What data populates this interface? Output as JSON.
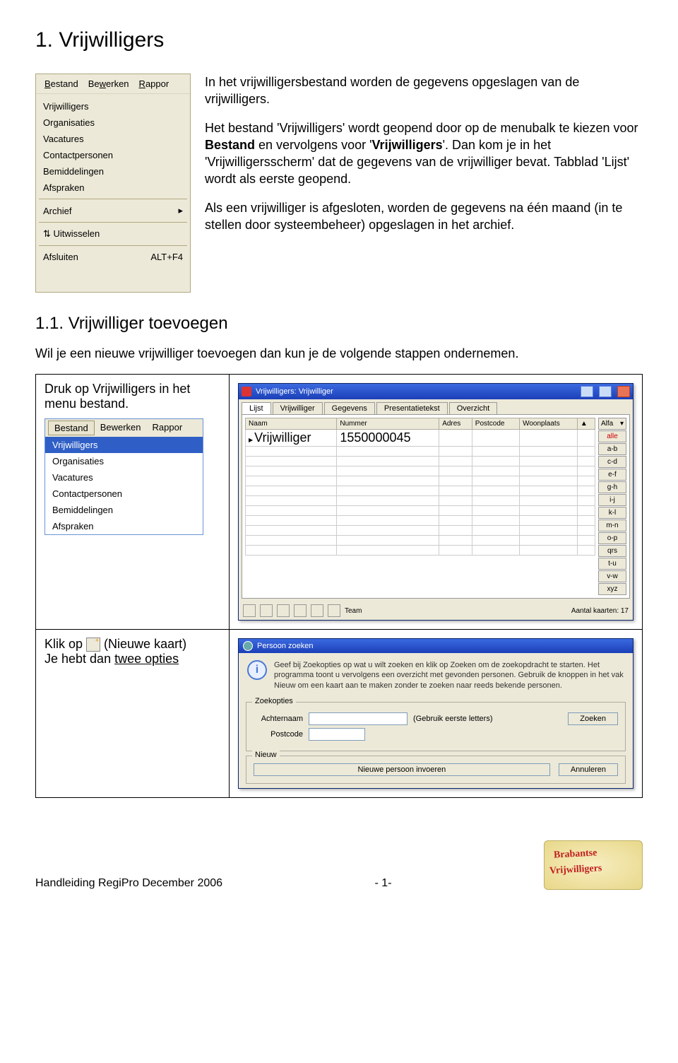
{
  "headings": {
    "h1": "1.  Vrijwilligers",
    "h2": "1.1. Vrijwilliger toevoegen"
  },
  "intro": {
    "p1": "In het vrijwilligersbestand worden de gegevens opgeslagen van de vrijwilligers.",
    "p2a": "Het bestand 'Vrijwilligers' wordt geopend door op de menubalk te kiezen voor ",
    "p2b": "Bestand",
    "p2c": " en vervolgens voor '",
    "p2d": "Vrijwilligers",
    "p2e": "'. Dan kom je in het 'Vrijwilligersscherm' dat de gegevens van de vrijwilliger bevat. Tabblad 'Lijst' wordt als eerste geopend.",
    "p3": "Als een vrijwilliger is afgesloten, worden de gegevens na één maand (in te stellen door systeembeheer) opgeslagen in het archief."
  },
  "sub_intro": "Wil je een nieuwe vrijwilliger toevoegen dan kun je de volgende stappen ondernemen.",
  "menu": {
    "bar": [
      "Bestand",
      "Bewerken",
      "Rappor"
    ],
    "items": [
      "Vrijwilligers",
      "Organisaties",
      "Vacatures",
      "Contactpersonen",
      "Bemiddelingen",
      "Afspraken"
    ],
    "archief": "Archief",
    "uitwisselen": "Uitwisselen",
    "afsluiten": "Afsluiten",
    "afsluiten_key": "ALT+F4"
  },
  "step1": {
    "text": "Druk op Vrijwilligers in het menu bestand.",
    "mini_bar": [
      "Bestand",
      "Bewerken",
      "Rappor"
    ],
    "mini_items": [
      "Vrijwilligers",
      "Organisaties",
      "Vacatures",
      "Contactpersonen",
      "Bemiddelingen",
      "Afspraken"
    ]
  },
  "vw": {
    "title": "Vrijwilligers: Vrijwilliger",
    "tabs": [
      "Lijst",
      "Vrijwilliger",
      "Gegevens",
      "Presentatietekst",
      "Overzicht"
    ],
    "cols": [
      "Naam",
      "Nummer",
      "Adres",
      "Postcode",
      "Woonplaats"
    ],
    "row": {
      "naam": "Vrijwilliger",
      "nummer": "1550000045"
    },
    "alfa_label": "Alfa",
    "alfa": [
      "alle",
      "a-b",
      "c-d",
      "e-f",
      "g-h",
      "i-j",
      "k-l",
      "m-n",
      "o-p",
      "qrs",
      "t-u",
      "v-w",
      "xyz"
    ],
    "tb_new": "+",
    "tb_team": "Team",
    "aantal": "Aantal kaarten: 17"
  },
  "step2": {
    "pre": "Klik op ",
    "mid": " (Nieuwe kaart)",
    "post": "Je hebt dan ",
    "opties": "twee opties"
  },
  "pz": {
    "title": "Persoon zoeken",
    "info": "Geef bij Zoekopties op wat u wilt zoeken en klik op Zoeken om de zoekopdracht te starten. Het programma toont u vervolgens een overzicht met gevonden personen. Gebruik de knoppen in het vak Nieuw om een kaart aan te maken zonder te zoeken naar reeds bekende personen.",
    "zoekopties": "Zoekopties",
    "achternaam": "Achternaam",
    "postcode": "Postcode",
    "hint": "(Gebruik eerste letters)",
    "zoeken": "Zoeken",
    "nieuw": "Nieuw",
    "nieuwe_persoon": "Nieuwe persoon invoeren",
    "annuleren": "Annuleren"
  },
  "footer": {
    "left": "Handleiding RegiPro December 2006",
    "page": "- 1-",
    "logo1": "Brabantse",
    "logo2": "Vrijwilligers"
  }
}
